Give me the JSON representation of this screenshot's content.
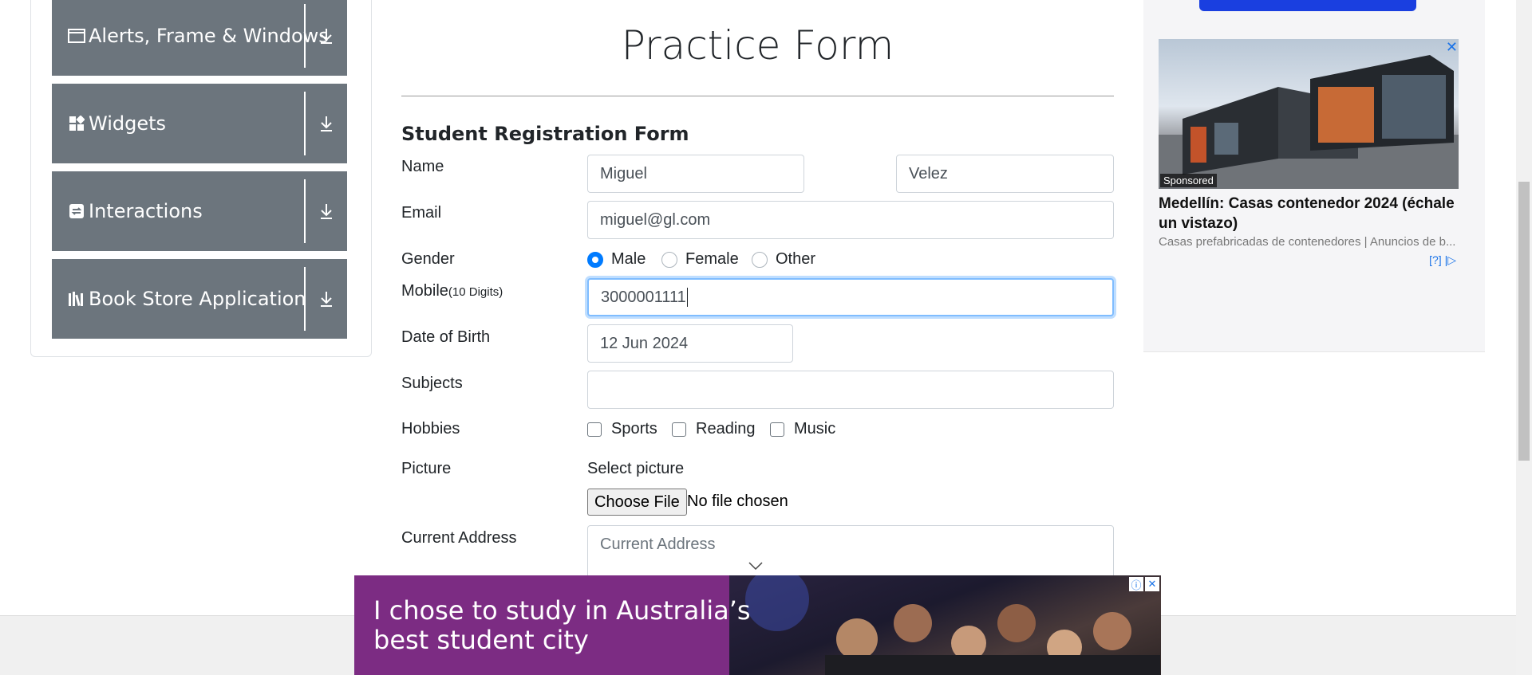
{
  "sidebar": {
    "groups": [
      {
        "label": "Alerts, Frame & Windows",
        "icon": "window-icon"
      },
      {
        "label": "Widgets",
        "icon": "widgets-icon"
      },
      {
        "label": "Interactions",
        "icon": "interactions-icon"
      },
      {
        "label": "Book Store Application",
        "icon": "books-icon"
      }
    ]
  },
  "main": {
    "title": "Practice Form",
    "form_heading": "Student Registration Form",
    "labels": {
      "name": "Name",
      "email": "Email",
      "gender": "Gender",
      "mobile": "Mobile",
      "mobile_hint": "(10 Digits)",
      "dob": "Date of Birth",
      "subjects": "Subjects",
      "hobbies": "Hobbies",
      "picture": "Picture",
      "address": "Current Address"
    },
    "fields": {
      "first_name": "Miguel",
      "last_name": "Velez",
      "email": "miguel@gl.com",
      "mobile": "3000001111",
      "dob": "12 Jun 2024",
      "subjects": "",
      "address_placeholder": "Current Address"
    },
    "gender_options": [
      {
        "label": "Male",
        "checked": true
      },
      {
        "label": "Female",
        "checked": false
      },
      {
        "label": "Other",
        "checked": false
      }
    ],
    "hobbies": [
      {
        "label": "Sports",
        "checked": false
      },
      {
        "label": "Reading",
        "checked": false
      },
      {
        "label": "Music",
        "checked": false
      }
    ],
    "picture": {
      "select_label": "Select picture",
      "button_label": "Choose File",
      "status": "No file chosen"
    }
  },
  "ad_right": {
    "sponsored": "Sponsored",
    "headline": "Medellín: Casas contenedor 2024 (échale un vistazo)",
    "description": "Casas prefabricadas de contenedores | Anuncios de b...",
    "choice": "[?]",
    "close": "✕"
  },
  "ad_bottom": {
    "text": "I chose to study in Australia’s best student city"
  },
  "colors": {
    "sidebar_group_bg": "#6c757d",
    "accent": "#007bff",
    "bottom_ad_bg": "#7c2c83"
  }
}
